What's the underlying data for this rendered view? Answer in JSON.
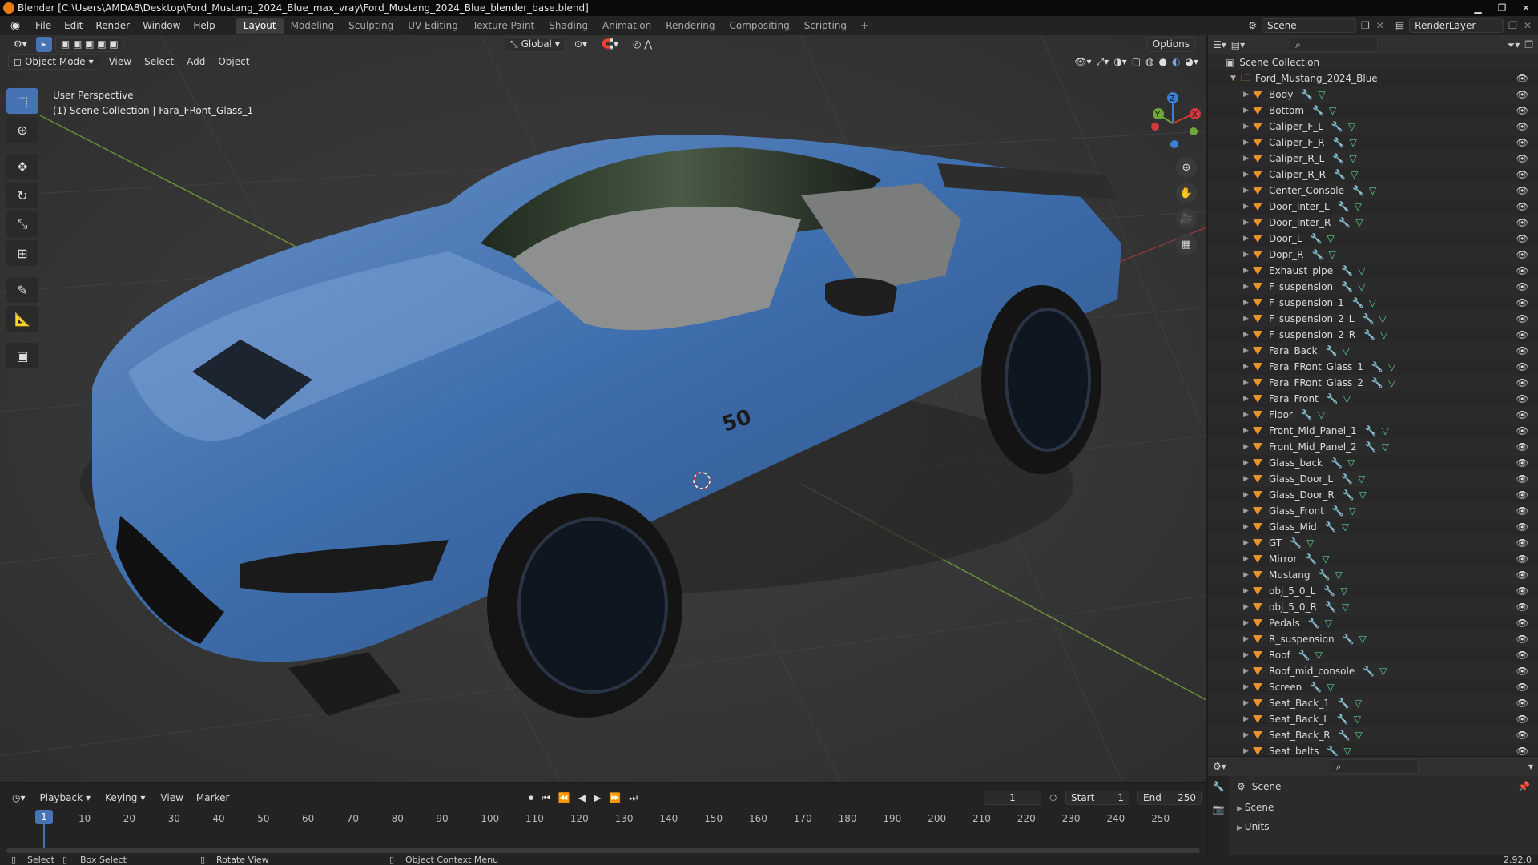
{
  "window": {
    "title": "Blender [C:\\Users\\AMDA8\\Desktop\\Ford_Mustang_2024_Blue_max_vray\\Ford_Mustang_2024_Blue_blender_base.blend]"
  },
  "menu": [
    "File",
    "Edit",
    "Render",
    "Window",
    "Help"
  ],
  "workspaces": [
    "Layout",
    "Modeling",
    "Sculpting",
    "UV Editing",
    "Texture Paint",
    "Shading",
    "Animation",
    "Rendering",
    "Compositing",
    "Scripting"
  ],
  "active_workspace": "Layout",
  "topbar": {
    "scene": "Scene",
    "render_layer": "RenderLayer"
  },
  "viewport": {
    "transform": "Global",
    "options": "Options",
    "mode": "Object Mode",
    "menus": [
      "View",
      "Select",
      "Add",
      "Object"
    ],
    "perspective": "User Perspective",
    "collection": "(1) Scene Collection | Fara_FRont_Glass_1",
    "car_badge": "50"
  },
  "outliner": {
    "root": "Scene Collection",
    "collection": "Ford_Mustang_2024_Blue",
    "items": [
      "Body",
      "Bottom",
      "Caliper_F_L",
      "Caliper_F_R",
      "Caliper_R_L",
      "Caliper_R_R",
      "Center_Console",
      "Door_Inter_L",
      "Door_Inter_R",
      "Door_L",
      "Dopr_R",
      "Exhaust_pipe",
      "F_suspension",
      "F_suspension_1",
      "F_suspension_2_L",
      "F_suspension_2_R",
      "Fara_Back",
      "Fara_FRont_Glass_1",
      "Fara_FRont_Glass_2",
      "Fara_Front",
      "Floor",
      "Front_Mid_Panel_1",
      "Front_Mid_Panel_2",
      "Glass_back",
      "Glass_Door_L",
      "Glass_Door_R",
      "Glass_Front",
      "Glass_Mid",
      "GT",
      "Mirror",
      "Mustang",
      "obj_5_0_L",
      "obj_5_0_R",
      "Pedals",
      "R_suspension",
      "Roof",
      "Roof_mid_console",
      "Screen",
      "Seat_Back_1",
      "Seat_Back_L",
      "Seat_Back_R",
      "Seat_belts"
    ]
  },
  "properties": {
    "title": "Scene",
    "sections": [
      "Scene",
      "Units"
    ]
  },
  "timeline": {
    "menus": [
      "Playback",
      "Keying",
      "View",
      "Marker"
    ],
    "current_frame": "1",
    "start_label": "Start",
    "start": "1",
    "end_label": "End",
    "end": "250",
    "ticks": [
      "10",
      "20",
      "30",
      "40",
      "50",
      "60",
      "70",
      "80",
      "90",
      "100",
      "110",
      "120",
      "130",
      "140",
      "150",
      "160",
      "170",
      "180",
      "190",
      "200",
      "210",
      "220",
      "230",
      "240",
      "250"
    ]
  },
  "status": {
    "select": "Select",
    "box_select": "Box Select",
    "rotate": "Rotate View",
    "context": "Object Context Menu",
    "version": "2.92.0"
  }
}
